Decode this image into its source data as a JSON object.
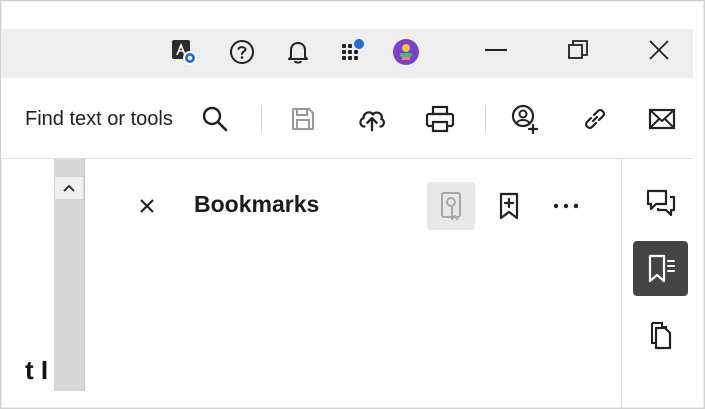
{
  "toolbar": {
    "search_label": "Find text or tools"
  },
  "panel": {
    "title": "Bookmarks",
    "more_label": "···"
  },
  "document": {
    "fragment_text": "t I"
  },
  "colors": {
    "titlebar_bg": "#eeeeee",
    "scrollbar": "#d6d6d6",
    "active_rail": "#444444",
    "notify_dot": "#1e6fe0",
    "avatar": "#7b3fd1"
  },
  "icons": {
    "acrobat": "acrobat-notification-icon",
    "help": "help-icon",
    "bell": "bell-icon",
    "apps": "apps-grid-icon",
    "avatar": "user-avatar-icon",
    "minimize": "minimize-icon",
    "restore": "restore-icon",
    "close": "close-icon",
    "search": "search-icon",
    "save": "save-icon",
    "cloud": "cloud-upload-icon",
    "print": "print-icon",
    "share": "add-people-icon",
    "link": "link-icon",
    "mail": "mail-icon",
    "bookmark_add": "add-bookmark-icon",
    "comment": "comment-icon",
    "bookmarks": "bookmarks-icon",
    "pages": "pages-icon"
  }
}
